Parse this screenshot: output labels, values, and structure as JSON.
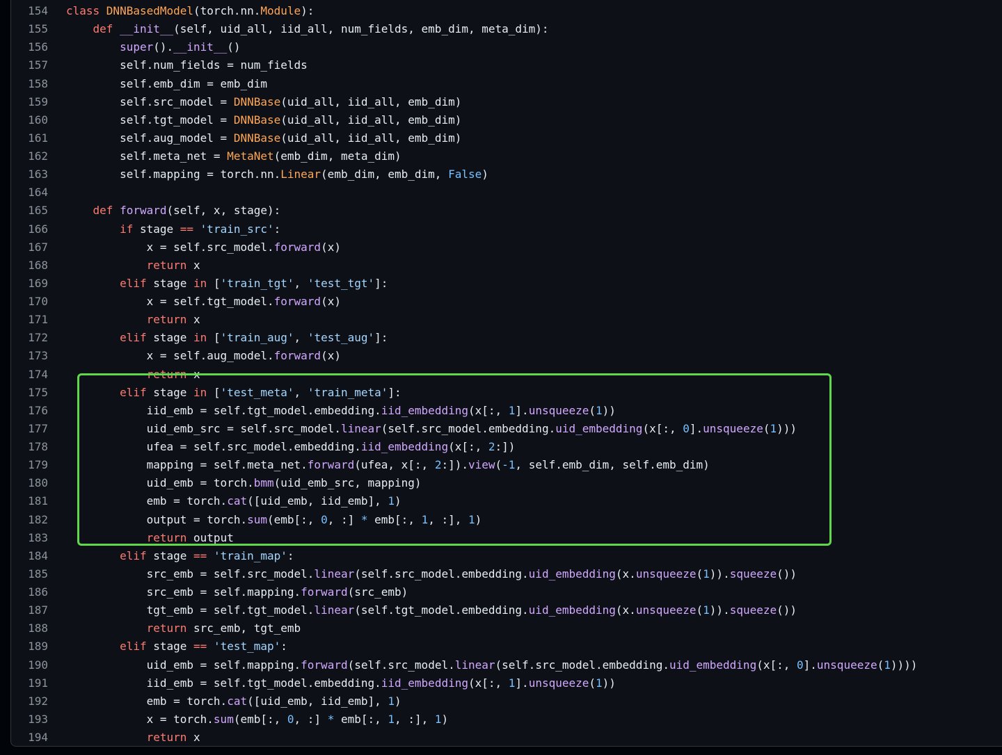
{
  "colors": {
    "keyword": "#ff7b72",
    "class": "#ffa657",
    "function": "#d2a8ff",
    "string": "#a5d6ff",
    "number": "#79c0ff",
    "plain": "#e6edf3",
    "line_number": "#8b949e",
    "highlight_box": "#5fd84c",
    "background": "#0d1117"
  },
  "code": {
    "lines": [
      {
        "n": "154",
        "tokens": [
          [
            "kw",
            "class "
          ],
          [
            "cls",
            "DNNBasedModel"
          ],
          [
            "pl",
            "(torch.nn."
          ],
          [
            "cls",
            "Module"
          ],
          [
            "pl",
            "):"
          ]
        ]
      },
      {
        "n": "155",
        "tokens": [
          [
            "pl",
            "    "
          ],
          [
            "kw",
            "def "
          ],
          [
            "fn",
            "__init__"
          ],
          [
            "pl",
            "(self, uid_all, iid_all, num_fields, emb_dim, meta_dim):"
          ]
        ]
      },
      {
        "n": "156",
        "tokens": [
          [
            "pl",
            "        "
          ],
          [
            "fn",
            "super"
          ],
          [
            "pl",
            "()."
          ],
          [
            "fn",
            "__init__"
          ],
          [
            "pl",
            "()"
          ]
        ]
      },
      {
        "n": "157",
        "tokens": [
          [
            "pl",
            "        self.num_fields = num_fields"
          ]
        ]
      },
      {
        "n": "158",
        "tokens": [
          [
            "pl",
            "        self.emb_dim = emb_dim"
          ]
        ]
      },
      {
        "n": "159",
        "tokens": [
          [
            "pl",
            "        self.src_model = "
          ],
          [
            "cls",
            "DNNBase"
          ],
          [
            "pl",
            "(uid_all, iid_all, emb_dim)"
          ]
        ]
      },
      {
        "n": "160",
        "tokens": [
          [
            "pl",
            "        self.tgt_model = "
          ],
          [
            "cls",
            "DNNBase"
          ],
          [
            "pl",
            "(uid_all, iid_all, emb_dim)"
          ]
        ]
      },
      {
        "n": "161",
        "tokens": [
          [
            "pl",
            "        self.aug_model = "
          ],
          [
            "cls",
            "DNNBase"
          ],
          [
            "pl",
            "(uid_all, iid_all, emb_dim)"
          ]
        ]
      },
      {
        "n": "162",
        "tokens": [
          [
            "pl",
            "        self.meta_net = "
          ],
          [
            "cls",
            "MetaNet"
          ],
          [
            "pl",
            "(emb_dim, meta_dim)"
          ]
        ]
      },
      {
        "n": "163",
        "tokens": [
          [
            "pl",
            "        self.mapping = torch.nn."
          ],
          [
            "cls",
            "Linear"
          ],
          [
            "pl",
            "(emb_dim, emb_dim, "
          ],
          [
            "num",
            "False"
          ],
          [
            "pl",
            ")"
          ]
        ]
      },
      {
        "n": "164",
        "tokens": [
          [
            "pl",
            ""
          ]
        ]
      },
      {
        "n": "165",
        "tokens": [
          [
            "pl",
            "    "
          ],
          [
            "kw",
            "def "
          ],
          [
            "fn",
            "forward"
          ],
          [
            "pl",
            "(self, x, stage):"
          ]
        ]
      },
      {
        "n": "166",
        "tokens": [
          [
            "pl",
            "        "
          ],
          [
            "kw",
            "if "
          ],
          [
            "pl",
            "stage "
          ],
          [
            "kw",
            "== "
          ],
          [
            "str",
            "'train_src'"
          ],
          [
            "pl",
            ":"
          ]
        ]
      },
      {
        "n": "167",
        "tokens": [
          [
            "pl",
            "            x = self.src_model."
          ],
          [
            "fn",
            "forward"
          ],
          [
            "pl",
            "(x)"
          ]
        ]
      },
      {
        "n": "168",
        "tokens": [
          [
            "pl",
            "            "
          ],
          [
            "kw",
            "return "
          ],
          [
            "pl",
            "x"
          ]
        ]
      },
      {
        "n": "169",
        "tokens": [
          [
            "pl",
            "        "
          ],
          [
            "kw",
            "elif "
          ],
          [
            "pl",
            "stage "
          ],
          [
            "kw",
            "in "
          ],
          [
            "pl",
            "["
          ],
          [
            "str",
            "'train_tgt'"
          ],
          [
            "pl",
            ", "
          ],
          [
            "str",
            "'test_tgt'"
          ],
          [
            "pl",
            "]:"
          ]
        ]
      },
      {
        "n": "170",
        "tokens": [
          [
            "pl",
            "            x = self.tgt_model."
          ],
          [
            "fn",
            "forward"
          ],
          [
            "pl",
            "(x)"
          ]
        ]
      },
      {
        "n": "171",
        "tokens": [
          [
            "pl",
            "            "
          ],
          [
            "kw",
            "return "
          ],
          [
            "pl",
            "x"
          ]
        ]
      },
      {
        "n": "172",
        "tokens": [
          [
            "pl",
            "        "
          ],
          [
            "kw",
            "elif "
          ],
          [
            "pl",
            "stage "
          ],
          [
            "kw",
            "in "
          ],
          [
            "pl",
            "["
          ],
          [
            "str",
            "'train_aug'"
          ],
          [
            "pl",
            ", "
          ],
          [
            "str",
            "'test_aug'"
          ],
          [
            "pl",
            "]:"
          ]
        ]
      },
      {
        "n": "173",
        "tokens": [
          [
            "pl",
            "            x = self.aug_model."
          ],
          [
            "fn",
            "forward"
          ],
          [
            "pl",
            "(x)"
          ]
        ]
      },
      {
        "n": "174",
        "tokens": [
          [
            "pl",
            "            "
          ],
          [
            "kw",
            "return "
          ],
          [
            "pl",
            "x"
          ]
        ]
      },
      {
        "n": "175",
        "tokens": [
          [
            "pl",
            "        "
          ],
          [
            "kw",
            "elif "
          ],
          [
            "pl",
            "stage "
          ],
          [
            "kw",
            "in "
          ],
          [
            "pl",
            "["
          ],
          [
            "str",
            "'test_meta'"
          ],
          [
            "pl",
            ", "
          ],
          [
            "str",
            "'train_meta'"
          ],
          [
            "pl",
            "]:"
          ]
        ]
      },
      {
        "n": "176",
        "tokens": [
          [
            "pl",
            "            iid_emb = self.tgt_model.embedding."
          ],
          [
            "fn",
            "iid_embedding"
          ],
          [
            "pl",
            "(x[:, "
          ],
          [
            "num",
            "1"
          ],
          [
            "pl",
            "]."
          ],
          [
            "fn",
            "unsqueeze"
          ],
          [
            "pl",
            "("
          ],
          [
            "num",
            "1"
          ],
          [
            "pl",
            "))"
          ]
        ]
      },
      {
        "n": "177",
        "tokens": [
          [
            "pl",
            "            uid_emb_src = self.src_model."
          ],
          [
            "fn",
            "linear"
          ],
          [
            "pl",
            "(self.src_model.embedding."
          ],
          [
            "fn",
            "uid_embedding"
          ],
          [
            "pl",
            "(x[:, "
          ],
          [
            "num",
            "0"
          ],
          [
            "pl",
            "]."
          ],
          [
            "fn",
            "unsqueeze"
          ],
          [
            "pl",
            "("
          ],
          [
            "num",
            "1"
          ],
          [
            "pl",
            ")))"
          ]
        ]
      },
      {
        "n": "178",
        "tokens": [
          [
            "pl",
            "            ufea = self.src_model.embedding."
          ],
          [
            "fn",
            "iid_embedding"
          ],
          [
            "pl",
            "(x[:, "
          ],
          [
            "num",
            "2"
          ],
          [
            "pl",
            ":])"
          ]
        ]
      },
      {
        "n": "179",
        "tokens": [
          [
            "pl",
            "            mapping = self.meta_net."
          ],
          [
            "fn",
            "forward"
          ],
          [
            "pl",
            "(ufea, x[:, "
          ],
          [
            "num",
            "2"
          ],
          [
            "pl",
            ":])."
          ],
          [
            "fn",
            "view"
          ],
          [
            "pl",
            "("
          ],
          [
            "num",
            "-1"
          ],
          [
            "pl",
            ", self.emb_dim, self.emb_dim)"
          ]
        ]
      },
      {
        "n": "180",
        "tokens": [
          [
            "pl",
            "            uid_emb = torch."
          ],
          [
            "fn",
            "bmm"
          ],
          [
            "pl",
            "(uid_emb_src, mapping)"
          ]
        ]
      },
      {
        "n": "181",
        "tokens": [
          [
            "pl",
            "            emb = torch."
          ],
          [
            "fn",
            "cat"
          ],
          [
            "pl",
            "([uid_emb, iid_emb], "
          ],
          [
            "num",
            "1"
          ],
          [
            "pl",
            ")"
          ]
        ]
      },
      {
        "n": "182",
        "tokens": [
          [
            "pl",
            "            output = torch."
          ],
          [
            "fn",
            "sum"
          ],
          [
            "pl",
            "(emb[:, "
          ],
          [
            "num",
            "0"
          ],
          [
            "pl",
            ", :] "
          ],
          [
            "num",
            "*"
          ],
          [
            "pl",
            " emb[:, "
          ],
          [
            "num",
            "1"
          ],
          [
            "pl",
            ", :], "
          ],
          [
            "num",
            "1"
          ],
          [
            "pl",
            ")"
          ]
        ]
      },
      {
        "n": "183",
        "tokens": [
          [
            "pl",
            "            "
          ],
          [
            "kw",
            "return "
          ],
          [
            "pl",
            "output"
          ]
        ]
      },
      {
        "n": "184",
        "tokens": [
          [
            "pl",
            "        "
          ],
          [
            "kw",
            "elif "
          ],
          [
            "pl",
            "stage "
          ],
          [
            "kw",
            "== "
          ],
          [
            "str",
            "'train_map'"
          ],
          [
            "pl",
            ":"
          ]
        ]
      },
      {
        "n": "185",
        "tokens": [
          [
            "pl",
            "            src_emb = self.src_model."
          ],
          [
            "fn",
            "linear"
          ],
          [
            "pl",
            "(self.src_model.embedding."
          ],
          [
            "fn",
            "uid_embedding"
          ],
          [
            "pl",
            "(x."
          ],
          [
            "fn",
            "unsqueeze"
          ],
          [
            "pl",
            "("
          ],
          [
            "num",
            "1"
          ],
          [
            "pl",
            "))."
          ],
          [
            "fn",
            "squeeze"
          ],
          [
            "pl",
            "())"
          ]
        ]
      },
      {
        "n": "186",
        "tokens": [
          [
            "pl",
            "            src_emb = self.mapping."
          ],
          [
            "fn",
            "forward"
          ],
          [
            "pl",
            "(src_emb)"
          ]
        ]
      },
      {
        "n": "187",
        "tokens": [
          [
            "pl",
            "            tgt_emb = self.tgt_model."
          ],
          [
            "fn",
            "linear"
          ],
          [
            "pl",
            "(self.tgt_model.embedding."
          ],
          [
            "fn",
            "uid_embedding"
          ],
          [
            "pl",
            "(x."
          ],
          [
            "fn",
            "unsqueeze"
          ],
          [
            "pl",
            "("
          ],
          [
            "num",
            "1"
          ],
          [
            "pl",
            "))."
          ],
          [
            "fn",
            "squeeze"
          ],
          [
            "pl",
            "())"
          ]
        ]
      },
      {
        "n": "188",
        "tokens": [
          [
            "pl",
            "            "
          ],
          [
            "kw",
            "return "
          ],
          [
            "pl",
            "src_emb, tgt_emb"
          ]
        ]
      },
      {
        "n": "189",
        "tokens": [
          [
            "pl",
            "        "
          ],
          [
            "kw",
            "elif "
          ],
          [
            "pl",
            "stage "
          ],
          [
            "kw",
            "== "
          ],
          [
            "str",
            "'test_map'"
          ],
          [
            "pl",
            ":"
          ]
        ]
      },
      {
        "n": "190",
        "tokens": [
          [
            "pl",
            "            uid_emb = self.mapping."
          ],
          [
            "fn",
            "forward"
          ],
          [
            "pl",
            "(self.src_model."
          ],
          [
            "fn",
            "linear"
          ],
          [
            "pl",
            "(self.src_model.embedding."
          ],
          [
            "fn",
            "uid_embedding"
          ],
          [
            "pl",
            "(x[:, "
          ],
          [
            "num",
            "0"
          ],
          [
            "pl",
            "]."
          ],
          [
            "fn",
            "unsqueeze"
          ],
          [
            "pl",
            "("
          ],
          [
            "num",
            "1"
          ],
          [
            "pl",
            "))))"
          ]
        ]
      },
      {
        "n": "191",
        "tokens": [
          [
            "pl",
            "            iid_emb = self.tgt_model.embedding."
          ],
          [
            "fn",
            "iid_embedding"
          ],
          [
            "pl",
            "(x[:, "
          ],
          [
            "num",
            "1"
          ],
          [
            "pl",
            "]."
          ],
          [
            "fn",
            "unsqueeze"
          ],
          [
            "pl",
            "("
          ],
          [
            "num",
            "1"
          ],
          [
            "pl",
            "))"
          ]
        ]
      },
      {
        "n": "192",
        "tokens": [
          [
            "pl",
            "            emb = torch."
          ],
          [
            "fn",
            "cat"
          ],
          [
            "pl",
            "([uid_emb, iid_emb], "
          ],
          [
            "num",
            "1"
          ],
          [
            "pl",
            ")"
          ]
        ]
      },
      {
        "n": "193",
        "tokens": [
          [
            "pl",
            "            x = torch."
          ],
          [
            "fn",
            "sum"
          ],
          [
            "pl",
            "(emb[:, "
          ],
          [
            "num",
            "0"
          ],
          [
            "pl",
            ", :] "
          ],
          [
            "num",
            "*"
          ],
          [
            "pl",
            " emb[:, "
          ],
          [
            "num",
            "1"
          ],
          [
            "pl",
            ", :], "
          ],
          [
            "num",
            "1"
          ],
          [
            "pl",
            ")"
          ]
        ]
      },
      {
        "n": "194",
        "tokens": [
          [
            "pl",
            "            "
          ],
          [
            "kw",
            "return "
          ],
          [
            "pl",
            "x"
          ]
        ]
      }
    ]
  }
}
